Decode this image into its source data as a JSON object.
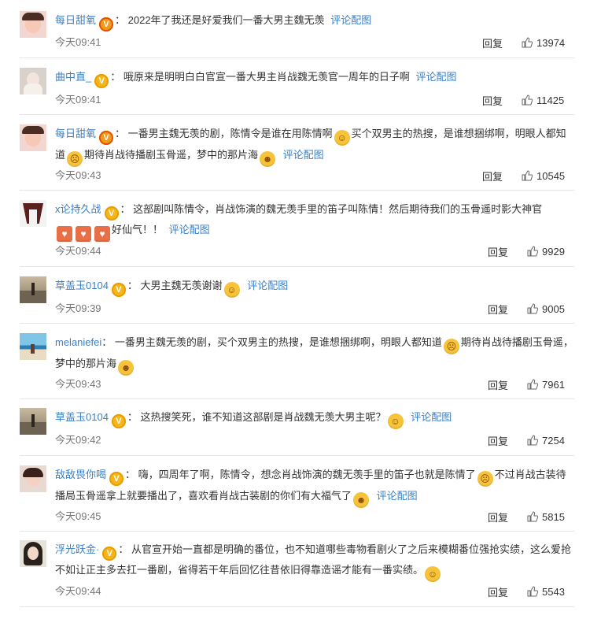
{
  "colors": {
    "username": "#3b80c5",
    "link": "#3b80c5",
    "meta": "#777777",
    "separator": "#e6e6e6"
  },
  "actions": {
    "reply": "回复",
    "comment_with_image": "评论配图"
  },
  "comments": [
    {
      "user": "每日甜氧",
      "badge": "red",
      "text": "2022年了我还是好爱我们一番大男主魏无羡",
      "time": "今天09:41",
      "likes": "13974"
    },
    {
      "user": "曲中直_",
      "badge": "gold",
      "text": "哦原来是明明白白官宣一番大男主肖战魏无羡官一周年的日子啊",
      "time": "今天09:41",
      "likes": "11425"
    },
    {
      "user": "每日甜氧",
      "badge": "red",
      "text_a": "一番男主魏无羡的剧，陈情令是谁在用陈情啊",
      "text_b": "买个双男主的热搜，是谁想捆绑啊，明眼人都知道",
      "text_c": "期待肖战待播剧玉骨遥，梦中的那片海",
      "time": "今天09:43",
      "likes": "10545"
    },
    {
      "user": "x论持久战",
      "badge": "gold",
      "text_a": "这部剧叫陈情令，肖战饰演的魏无羡手里的笛子叫陈情！然后期待我们的玉骨遥时影大神官",
      "text_b": "好仙气！！",
      "time": "今天09:44",
      "likes": "9929"
    },
    {
      "user": "草盖玉0104",
      "badge": "gold",
      "text": "大男主魏无羡谢谢",
      "time": "今天09:39",
      "likes": "9005"
    },
    {
      "user": "melaniefei",
      "badge": "",
      "text_a": "一番男主魏无羡的剧，买个双男主的热搜，是谁想捆绑啊，明眼人都知道",
      "text_b": "期待肖战待播剧玉骨遥，梦中的那片海",
      "time": "今天09:43",
      "likes": "7961"
    },
    {
      "user": "草盖玉0104",
      "badge": "gold",
      "text": "这热搜笑死，谁不知道这部剧是肖战魏无羡大男主呢？",
      "time": "今天09:42",
      "likes": "7254"
    },
    {
      "user": "敌敌畏你喝",
      "badge": "gold",
      "text_a": "嗨，四周年了啊，陈情令，想念肖战饰演的魏无羡手里的笛子也就是陈情了",
      "text_b": "不过肖战古装待播局玉骨遥拿上就要播出了，喜欢看肖战古装剧的你们有大福气了",
      "time": "今天09:45",
      "likes": "5815"
    },
    {
      "user": "浮光跃金·",
      "badge": "gold",
      "text": "从官宣开始一直都是明确的番位，也不知道哪些毒物看剧火了之后来模糊番位强抢实绩，这么爱抢不如让正主多去扛一番剧，省得若干年后回忆往昔依旧得靠造谣才能有一番实绩。",
      "time": "今天09:44",
      "likes": "5543"
    }
  ]
}
